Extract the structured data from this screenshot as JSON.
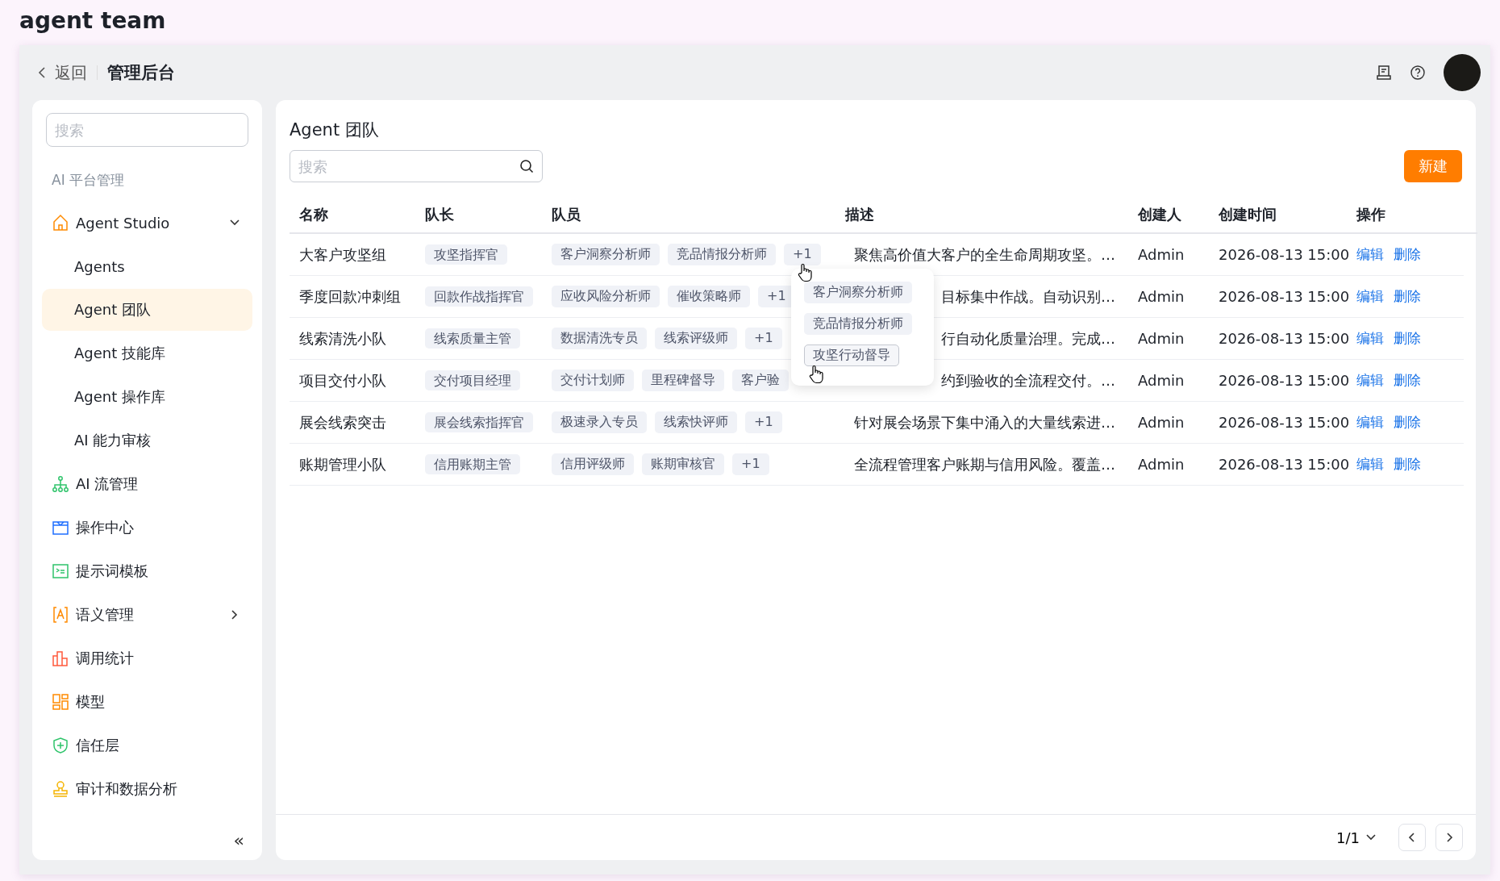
{
  "app_title": "agent team",
  "header": {
    "back": "返回",
    "title": "管理后台"
  },
  "sidebar": {
    "search": {
      "placeholder": "搜索"
    },
    "section": "AI 平台管理",
    "collapse": "«",
    "items": [
      {
        "label": "Agent Studio",
        "kind": "group",
        "expanded": true,
        "selected": false,
        "children": [
          {
            "label": "Agents",
            "selected": false
          },
          {
            "label": "Agent 团队",
            "selected": true
          },
          {
            "label": "Agent 技能库",
            "selected": false
          },
          {
            "label": "Agent 操作库",
            "selected": false
          },
          {
            "label": "AI 能力审核",
            "selected": false
          }
        ]
      },
      {
        "label": "AI 流管理",
        "kind": "link",
        "selected": false
      },
      {
        "label": "操作中心",
        "kind": "link",
        "selected": false
      },
      {
        "label": "提示词模板",
        "kind": "link",
        "selected": false
      },
      {
        "label": "语义管理",
        "kind": "group",
        "expanded": false,
        "selected": false
      },
      {
        "label": "调用统计",
        "kind": "link",
        "selected": false
      },
      {
        "label": "模型",
        "kind": "link",
        "selected": false
      },
      {
        "label": "信任层",
        "kind": "link",
        "selected": false
      },
      {
        "label": "审计和数据分析",
        "kind": "link",
        "selected": false
      }
    ]
  },
  "main": {
    "title": "Agent 团队",
    "search": {
      "placeholder": "搜索"
    },
    "new_button": "新建",
    "table": {
      "columns": [
        "名称",
        "队长",
        "队员",
        "描述",
        "创建人",
        "创建时间",
        "操作"
      ],
      "rows": [
        {
          "name": "大客户攻坚组",
          "leader": "攻坚指挥官",
          "members": [
            "客户洞察分析师",
            "竞品情报分析师"
          ],
          "more": "+1",
          "description": "聚焦高价值大客户的全生命周期攻坚。…",
          "creator": "Admin",
          "created": "2026-08-13 15:00",
          "actions": [
            "编辑",
            "删除"
          ]
        },
        {
          "name": "季度回款冲刺组",
          "leader": "回款作战指挥官",
          "members": [
            "应收风险分析师",
            "催收策略师"
          ],
          "more": "+1",
          "description": "目标集中作战。自动识别…",
          "creator": "Admin",
          "created": "2026-08-13 15:00",
          "actions": [
            "编辑",
            "删除"
          ]
        },
        {
          "name": "线索清洗小队",
          "leader": "线索质量主管",
          "members": [
            "数据清洗专员",
            "线索评级师"
          ],
          "more": "+1",
          "description": "行自动化质量治理。完成…",
          "creator": "Admin",
          "created": "2026-08-13 15:00",
          "actions": [
            "编辑",
            "删除"
          ]
        },
        {
          "name": "项目交付小队",
          "leader": "交付项目经理",
          "members": [
            "交付计划师",
            "里程碑督导",
            "客户验"
          ],
          "description": "约到验收的全流程交付。…",
          "creator": "Admin",
          "created": "2026-08-13 15:00",
          "actions": [
            "编辑",
            "删除"
          ]
        },
        {
          "name": "展会线索突击",
          "leader": "展会线索指挥官",
          "members": [
            "极速录入专员",
            "线索快评师"
          ],
          "more": "+1",
          "description": "针对展会场景下集中涌入的大量线索进…",
          "creator": "Admin",
          "created": "2026-08-13 15:00",
          "actions": [
            "编辑",
            "删除"
          ]
        },
        {
          "name": "账期管理小队",
          "leader": "信用账期主管",
          "members": [
            "信用评级师",
            "账期审核官"
          ],
          "more": "+1",
          "description": "全流程管理客户账期与信用风险。覆盖…",
          "creator": "Admin",
          "created": "2026-08-13 15:00",
          "actions": [
            "编辑",
            "删除"
          ]
        }
      ]
    },
    "popover": {
      "items": [
        {
          "label": "客户洞察分析师",
          "hovered": false
        },
        {
          "label": "竞品情报分析师",
          "hovered": false
        },
        {
          "label": "攻坚行动督导",
          "hovered": true
        }
      ]
    },
    "pagination": {
      "page": "1/1"
    }
  }
}
